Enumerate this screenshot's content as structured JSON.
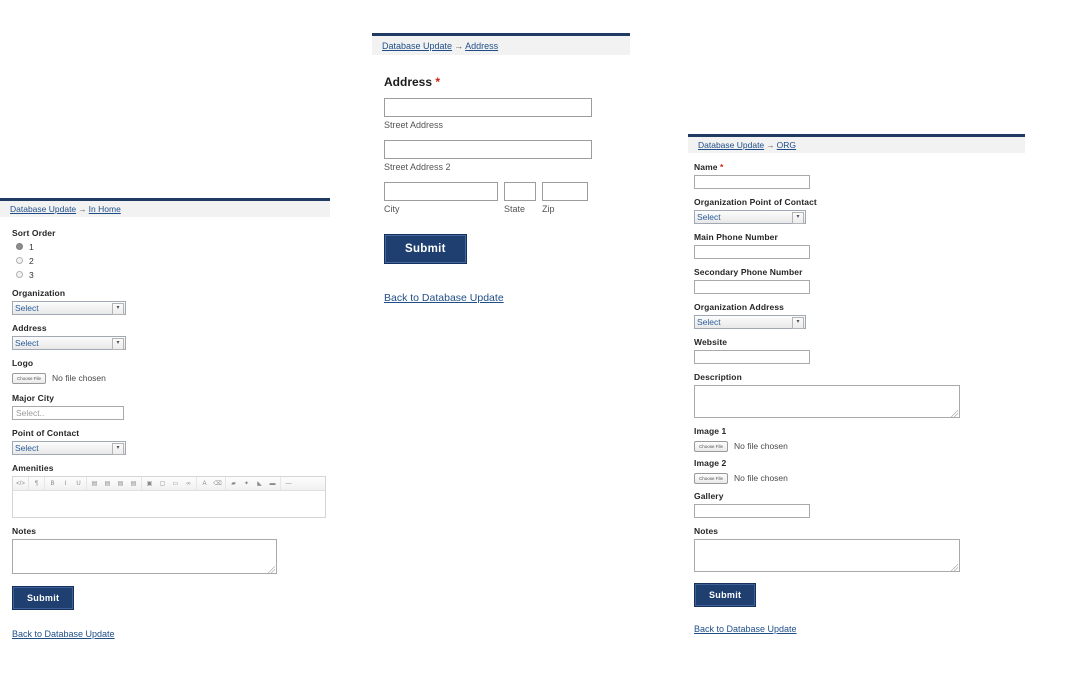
{
  "panels": {
    "in_home": {
      "breadcrumb": {
        "root": "Database Update",
        "sep": "→",
        "current": "In Home"
      },
      "fields": {
        "sort_order": {
          "label": "Sort Order",
          "options": [
            "1",
            "2",
            "3"
          ],
          "selected": "1"
        },
        "organization": {
          "label": "Organization",
          "value": "Select"
        },
        "address": {
          "label": "Address",
          "value": "Select"
        },
        "logo": {
          "label": "Logo",
          "button": "Choose File",
          "status": "No file chosen"
        },
        "major_city": {
          "label": "Major City",
          "placeholder": "Select..",
          "value": ""
        },
        "point_of_contact": {
          "label": "Point of Contact",
          "value": "Select"
        },
        "amenities": {
          "label": "Amenities",
          "value": ""
        },
        "notes": {
          "label": "Notes",
          "value": ""
        }
      },
      "submit_label": "Submit",
      "back_link": "Back to Database Update"
    },
    "address": {
      "breadcrumb": {
        "root": "Database Update",
        "sep": "→",
        "current": "Address"
      },
      "heading": "Address",
      "required_mark": "*",
      "fields": {
        "street1": {
          "sublabel": "Street Address",
          "value": ""
        },
        "street2": {
          "sublabel": "Street Address 2",
          "value": ""
        },
        "city": {
          "sublabel": "City",
          "value": ""
        },
        "state": {
          "sublabel": "State",
          "value": ""
        },
        "zip": {
          "sublabel": "Zip",
          "value": ""
        }
      },
      "submit_label": "Submit",
      "back_link": "Back to Database Update"
    },
    "org": {
      "breadcrumb": {
        "root": "Database Update",
        "sep": "→",
        "current": "ORG"
      },
      "fields": {
        "name": {
          "label": "Name",
          "required_mark": "*",
          "value": ""
        },
        "org_poc": {
          "label": "Organization Point of Contact",
          "value": "Select"
        },
        "main_phone": {
          "label": "Main Phone Number",
          "value": ""
        },
        "secondary_phone": {
          "label": "Secondary Phone Number",
          "value": ""
        },
        "org_address": {
          "label": "Organization Address",
          "value": "Select"
        },
        "website": {
          "label": "Website",
          "value": ""
        },
        "description": {
          "label": "Description",
          "value": ""
        },
        "image1": {
          "label": "Image 1",
          "button": "Choose File",
          "status": "No file chosen"
        },
        "image2": {
          "label": "Image 2",
          "button": "Choose File",
          "status": "No file chosen"
        },
        "gallery": {
          "label": "Gallery",
          "value": ""
        },
        "notes": {
          "label": "Notes",
          "value": ""
        }
      },
      "submit_label": "Submit",
      "back_link": "Back to Database Update"
    }
  },
  "editor_toolbar": {
    "groups": [
      {
        "buttons": [
          {
            "icon": "source-code-icon",
            "glyph": "&lt;/&gt;"
          }
        ]
      },
      {
        "buttons": [
          {
            "icon": "paragraph-format-icon",
            "glyph": "¶"
          }
        ]
      },
      {
        "buttons": [
          {
            "icon": "bold-icon",
            "glyph": "B"
          },
          {
            "icon": "italic-icon",
            "glyph": "I"
          },
          {
            "icon": "underline-icon",
            "glyph": "U"
          }
        ]
      },
      {
        "buttons": [
          {
            "icon": "align-left-icon",
            "glyph": "▤"
          },
          {
            "icon": "align-center-icon",
            "glyph": "▤"
          },
          {
            "icon": "align-right-icon",
            "glyph": "▤"
          },
          {
            "icon": "align-justify-icon",
            "glyph": "▤"
          }
        ]
      },
      {
        "buttons": [
          {
            "icon": "insert-image-icon",
            "glyph": "▣"
          },
          {
            "icon": "insert-video-icon",
            "glyph": "▢"
          },
          {
            "icon": "insert-embed-icon",
            "glyph": "▭"
          },
          {
            "icon": "insert-link-icon",
            "glyph": "∞"
          }
        ]
      },
      {
        "buttons": [
          {
            "icon": "text-color-icon",
            "glyph": "A"
          },
          {
            "icon": "clear-format-icon",
            "glyph": "⌫"
          }
        ]
      },
      {
        "buttons": [
          {
            "icon": "indent-icon",
            "glyph": "▰"
          },
          {
            "icon": "bullet-list-icon",
            "glyph": "✦"
          },
          {
            "icon": "outdent-icon",
            "glyph": "◣"
          },
          {
            "icon": "numbered-list-icon",
            "glyph": "▬"
          }
        ]
      },
      {
        "buttons": [
          {
            "icon": "horizontal-rule-icon",
            "glyph": "—"
          }
        ]
      }
    ]
  },
  "colors": {
    "accent": "#1f3a63",
    "link": "#1f4e87",
    "submit_bg": "#1e3f70",
    "required": "#d11d12",
    "header_bg": "#f2f2f2"
  }
}
